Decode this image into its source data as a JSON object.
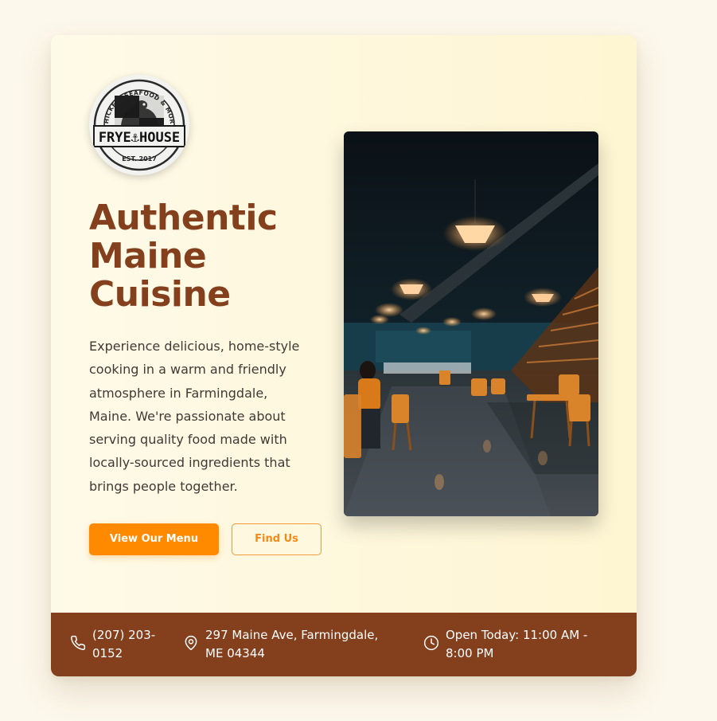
{
  "logo": {
    "icon": "frye-house-logo",
    "top_text": "CHICKEN, SEAFOOD & MORE",
    "name": "FRYE⚓HOUSE",
    "est": "EST. 2017"
  },
  "hero": {
    "title": "Authentic Maine Cuisine",
    "description": "Experience delicious, home-style cooking in a warm and friendly atmosphere in Farmingdale, Maine. We're passionate about serving quality food made with locally-sourced ingredients that brings people together.",
    "primary_button": "View Our Menu",
    "secondary_button": "Find Us"
  },
  "image": {
    "subject": "restaurant-interior-photo"
  },
  "footer": {
    "phone": "(207) 203-0152",
    "address": "297 Maine Ave, Farmingdale, ME 04344",
    "hours": "Open Today: 11:00 AM - 8:00 PM",
    "icons": [
      "phone-icon",
      "map-pin-icon",
      "clock-icon"
    ]
  },
  "colors": {
    "page_bg": "#fdf8ec",
    "brand_brown": "#843f1d",
    "accent_orange": "#ff8a00",
    "text_dark": "#3f3a35"
  }
}
